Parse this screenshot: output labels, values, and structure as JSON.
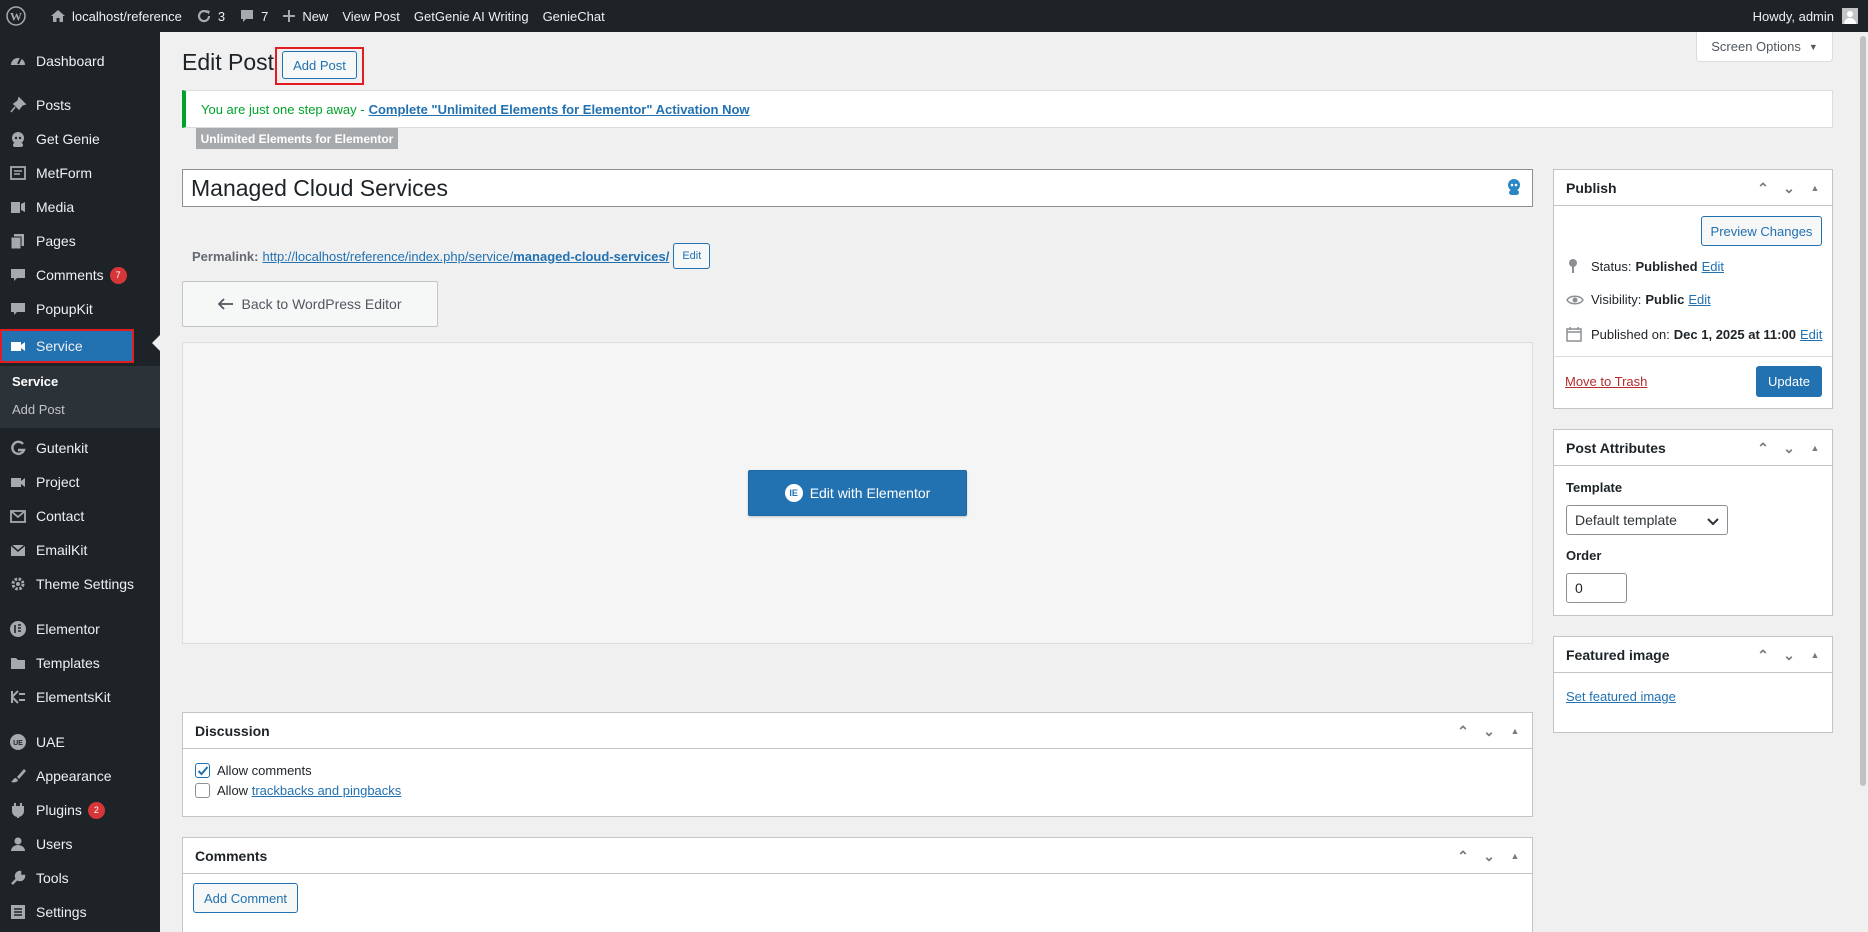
{
  "adminbar": {
    "site_name": "localhost/reference",
    "updates_count": "3",
    "comments_count": "7",
    "new_label": "New",
    "view_post": "View Post",
    "getgenie": "GetGenie AI Writing",
    "geniechat": "GenieChat",
    "howdy": "Howdy, admin"
  },
  "sidebar": {
    "items": [
      {
        "label": "Dashboard",
        "icon": "dashboard-icon"
      },
      {
        "label": "Posts",
        "icon": "pin-icon"
      },
      {
        "label": "Get Genie",
        "icon": "genie-icon"
      },
      {
        "label": "MetForm",
        "icon": "form-icon"
      },
      {
        "label": "Media",
        "icon": "media-icon"
      },
      {
        "label": "Pages",
        "icon": "pages-icon"
      },
      {
        "label": "Comments",
        "icon": "comments-icon",
        "badge": "7"
      },
      {
        "label": "PopupKit",
        "icon": "popup-icon"
      },
      {
        "label": "Service",
        "icon": "video-icon"
      },
      {
        "label": "Gutenkit",
        "icon": "gutenkit-icon"
      },
      {
        "label": "Project",
        "icon": "project-icon"
      },
      {
        "label": "Contact",
        "icon": "mail-icon"
      },
      {
        "label": "EmailKit",
        "icon": "emailkit-icon"
      },
      {
        "label": "Theme Settings",
        "icon": "gear-icon"
      },
      {
        "label": "Elementor",
        "icon": "elementor-icon"
      },
      {
        "label": "Templates",
        "icon": "folder-icon"
      },
      {
        "label": "ElementsKit",
        "icon": "elementskit-icon"
      },
      {
        "label": "UAE",
        "icon": "uae-icon"
      },
      {
        "label": "Appearance",
        "icon": "brush-icon"
      },
      {
        "label": "Plugins",
        "icon": "plugin-icon",
        "badge": "2"
      },
      {
        "label": "Users",
        "icon": "users-icon"
      },
      {
        "label": "Tools",
        "icon": "wrench-icon"
      },
      {
        "label": "Settings",
        "icon": "settings-icon"
      }
    ],
    "submenu": [
      "Service",
      "Add Post"
    ]
  },
  "page": {
    "title": "Edit Post",
    "add_post": "Add Post",
    "screen_options": "Screen Options"
  },
  "notice": {
    "text": "You are just one step away -",
    "link": "Complete \"Unlimited Elements for Elementor\" Activation Now",
    "tag": "Unlimited Elements for Elementor"
  },
  "post": {
    "title": "Managed Cloud Services",
    "permalink_label": "Permalink:",
    "permalink_base": "http://localhost/reference/index.php/service/",
    "permalink_slug": "managed-cloud-services/",
    "permalink_edit": "Edit",
    "back_button": "Back to WordPress Editor",
    "elementor_button": "Edit with Elementor"
  },
  "discussion": {
    "title": "Discussion",
    "allow_comments": "Allow comments",
    "allow_comments_checked": true,
    "allow_prefix": "Allow",
    "trackbacks_link": "trackbacks and pingbacks",
    "trackbacks_checked": false
  },
  "comments_box": {
    "title": "Comments",
    "add_comment": "Add Comment"
  },
  "publish": {
    "title": "Publish",
    "preview": "Preview Changes",
    "status_label": "Status:",
    "status_value": "Published",
    "visibility_label": "Visibility:",
    "visibility_value": "Public",
    "published_label": "Published on:",
    "published_value": "Dec 1, 2025 at 11:00",
    "edit": "Edit",
    "trash": "Move to Trash",
    "update": "Update"
  },
  "attributes": {
    "title": "Post Attributes",
    "template_label": "Template",
    "template_value": "Default template",
    "order_label": "Order",
    "order_value": "0"
  },
  "featured": {
    "title": "Featured image",
    "link": "Set featured image"
  }
}
